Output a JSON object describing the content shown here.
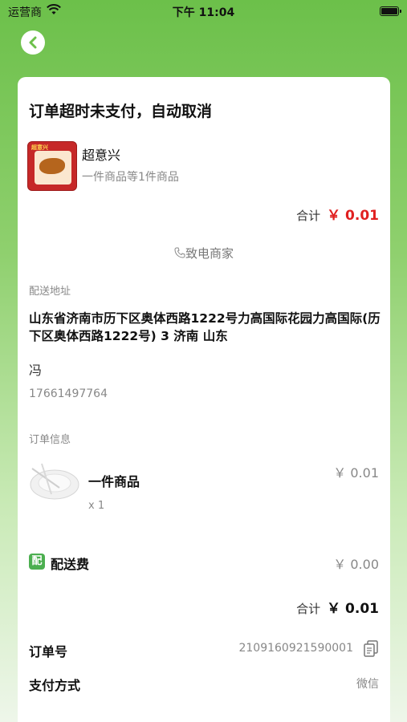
{
  "status_bar": {
    "carrier": "运营商",
    "time": "下午 11:04"
  },
  "order": {
    "status_title": "订单超时未支付，自动取消",
    "shop": {
      "name": "超意兴",
      "summary": "一件商品等1件商品",
      "logo_text": "超意兴"
    },
    "total_label": "合计",
    "total_amount": "￥ 0.01",
    "call_merchant": "致电商家",
    "delivery": {
      "section_label": "配送地址",
      "address": "山东省济南市历下区奥体西路1222号力高国际花园力高国际(历下区奥体西路1222号) 3 济南 山东",
      "recipient": "冯",
      "phone": "17661497764"
    },
    "info": {
      "section_label": "订单信息",
      "item_name": "一件商品",
      "item_qty": "x 1",
      "item_price": "￥ 0.01",
      "fee_icon_text": "配",
      "fee_label": "配送费",
      "fee_value": "￥ 0.00",
      "total_label": "合计",
      "total_amount": "￥ 0.01"
    },
    "order_no_label": "订单号",
    "order_no_value": "2109160921590001",
    "payment_label": "支付方式",
    "payment_value": "微信"
  },
  "colors": {
    "brand_green": "#6cc04a",
    "price_red": "#e02020",
    "fee_icon_green": "#4caf50"
  }
}
